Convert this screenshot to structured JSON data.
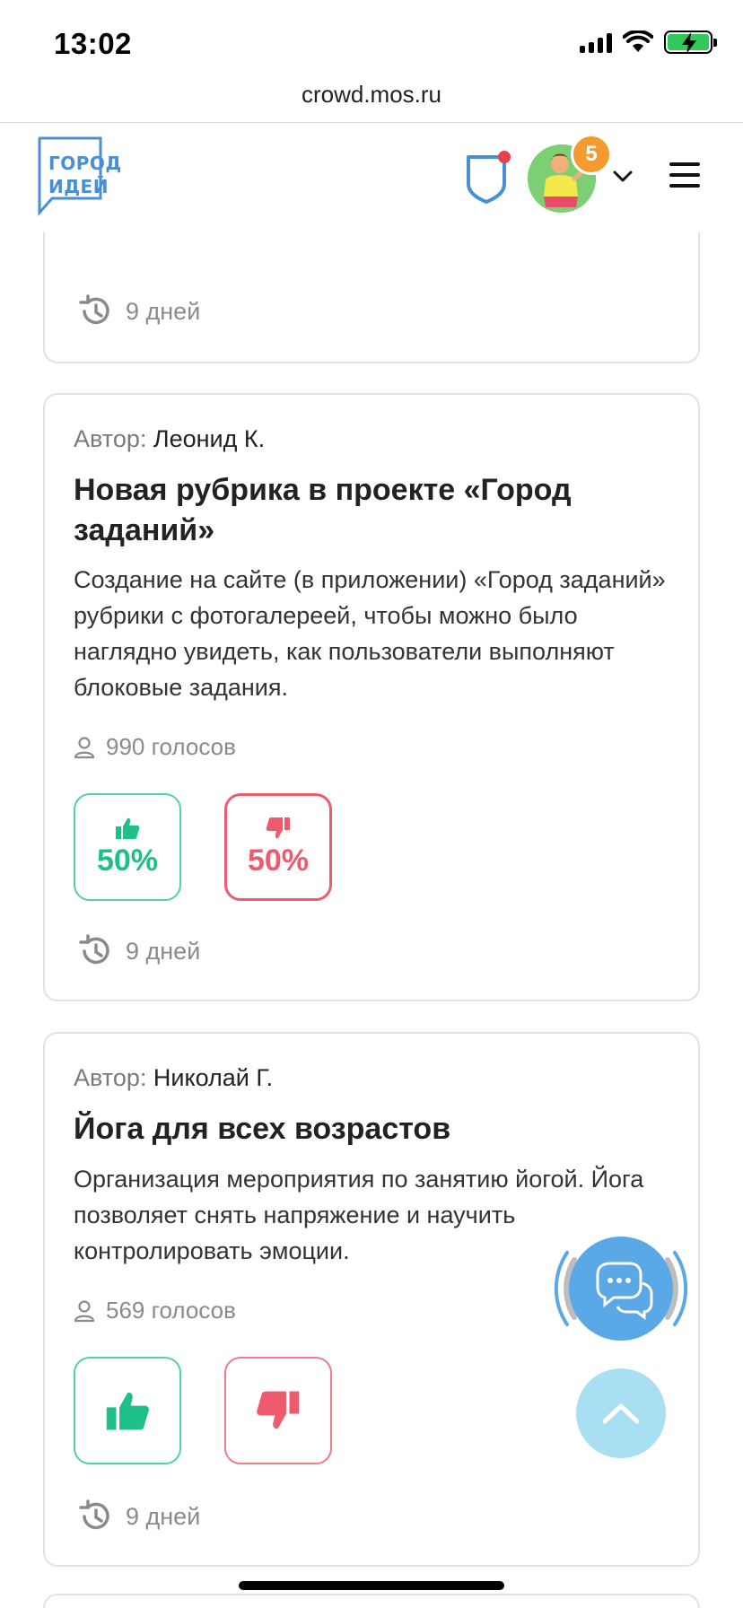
{
  "status_bar": {
    "time": "13:02",
    "icons": [
      "signal-icon",
      "wifi-icon",
      "battery-charging-icon"
    ]
  },
  "browser": {
    "url": "crowd.mos.ru"
  },
  "header": {
    "logo_line1": "ГОРОД",
    "logo_line2": "ИДЕЙ",
    "notification_count": "5"
  },
  "colors": {
    "like": "#1fbf8a",
    "dislike": "#ee5b6e",
    "brand_blue": "#4a8fd6",
    "badge": "#f59a2f",
    "fab_chat": "#5aa8e6",
    "fab_up": "#a9dff3"
  },
  "cards": [
    {
      "time": "9 дней"
    },
    {
      "author_label": "Автор:",
      "author": "Леонид К.",
      "title": "Новая рубрика в проекте «Город заданий»",
      "description": "Создание на сайте (в приложении) «Город заданий» рубрики с фотогалереей, чтобы можно было наглядно увидеть, как пользователи выполняют блоковые задания.",
      "votes": "990 голосов",
      "like_percent": "50%",
      "dislike_percent": "50%",
      "time": "9 дней"
    },
    {
      "author_label": "Автор:",
      "author": "Николай Г.",
      "title": "Йога для всех возрастов",
      "description": "Организация мероприятия по занятию йогой. Йога позволяет снять напряжение и научить контролировать эмоции.",
      "votes": "569 голосов",
      "time": "9 дней"
    }
  ]
}
